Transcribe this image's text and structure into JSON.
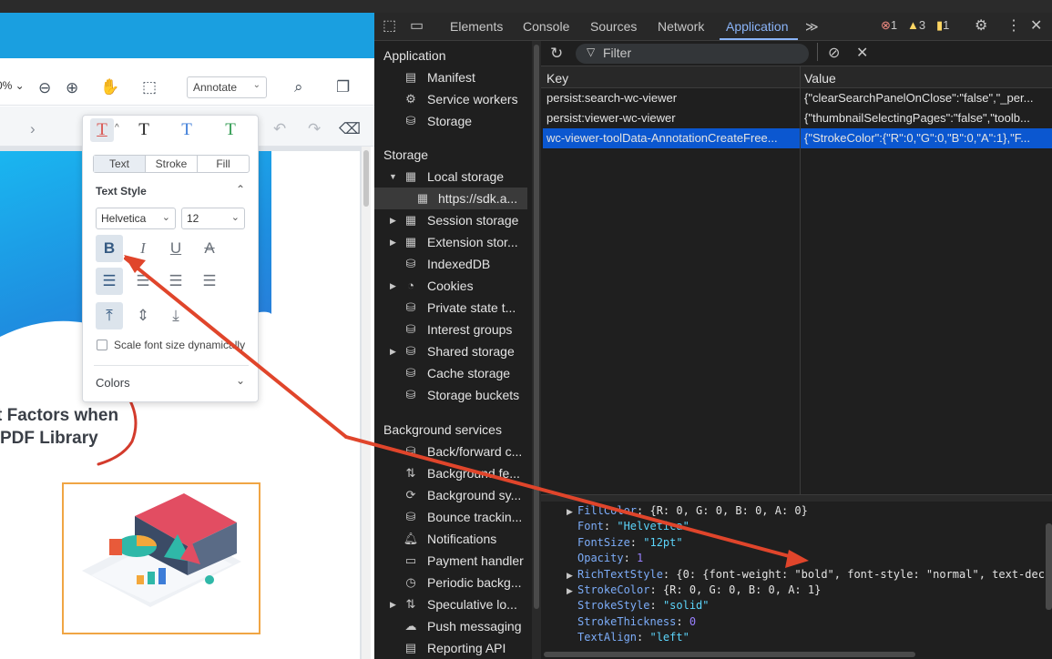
{
  "viewer": {
    "zoom_label": "0% ⌄",
    "annotate_select": "Annotate",
    "headline_line1": "t Factors when",
    "headline_line2": "PDF Library",
    "popup": {
      "tabs": [
        "Text",
        "Stroke",
        "Fill"
      ],
      "active_tab": "Text",
      "text_style_label": "Text Style",
      "font_family": "Helvetica",
      "font_size": "12",
      "scale_font_label": "Scale font size dynamically",
      "colors_label": "Colors",
      "style_colors": [
        "#d9534f",
        "#222222",
        "#3d7dd8",
        "#2e9a4f"
      ]
    }
  },
  "devtools": {
    "tabs": [
      "Elements",
      "Console",
      "Sources",
      "Network",
      "Application"
    ],
    "active_tab": "Application",
    "more_tabs": "≫",
    "errors": "1",
    "warnings": "3",
    "issues": "1",
    "sidebar": {
      "application_header": "Application",
      "application_items": [
        "Manifest",
        "Service workers",
        "Storage"
      ],
      "storage_header": "Storage",
      "storage_items": [
        "Local storage",
        "https://sdk.a...",
        "Session storage",
        "Extension stor...",
        "IndexedDB",
        "Cookies",
        "Private state t...",
        "Interest groups",
        "Shared storage",
        "Cache storage",
        "Storage buckets"
      ],
      "background_header": "Background services",
      "background_items": [
        "Back/forward c...",
        "Background fe...",
        "Background sy...",
        "Bounce trackin...",
        "Notifications",
        "Payment handler",
        "Periodic backg...",
        "Speculative lo...",
        "Push messaging",
        "Reporting API"
      ]
    },
    "filter_placeholder": "Filter",
    "table": {
      "col_key": "Key",
      "col_value": "Value",
      "rows": [
        {
          "key": "persist:search-wc-viewer",
          "value": "{\"clearSearchPanelOnClose\":\"false\",\"_per..."
        },
        {
          "key": "persist:viewer-wc-viewer",
          "value": "{\"thumbnailSelectingPages\":\"false\",\"toolb..."
        },
        {
          "key": "wc-viewer-toolData-AnnotationCreateFree...",
          "value": "{\"StrokeColor\":{\"R\":0,\"G\":0,\"B\":0,\"A\":1},\"F..."
        }
      ]
    },
    "json_preview": [
      {
        "key": "FillColor",
        "value": "{R: 0, G: 0, B: 0, A: 0}",
        "type": "obj",
        "expandable": true
      },
      {
        "key": "Font",
        "value": "\"Helvetica\"",
        "type": "str",
        "expandable": false
      },
      {
        "key": "FontSize",
        "value": "\"12pt\"",
        "type": "str",
        "expandable": false
      },
      {
        "key": "Opacity",
        "value": "1",
        "type": "num",
        "expandable": false
      },
      {
        "key": "RichTextStyle",
        "value": "{0: {font-weight: \"bold\", font-style: \"normal\", text-dec",
        "type": "obj",
        "expandable": true
      },
      {
        "key": "StrokeColor",
        "value": "{R: 0, G: 0, B: 0, A: 1}",
        "type": "obj",
        "expandable": true
      },
      {
        "key": "StrokeStyle",
        "value": "\"solid\"",
        "type": "str",
        "expandable": false
      },
      {
        "key": "StrokeThickness",
        "value": "0",
        "type": "num",
        "expandable": false
      },
      {
        "key": "TextAlign",
        "value": "\"left\"",
        "type": "str",
        "expandable": false
      }
    ],
    "colors": {
      "accent": "#8ab4f8",
      "selection": "#0b57d0",
      "arrow": "#e0452b"
    }
  }
}
